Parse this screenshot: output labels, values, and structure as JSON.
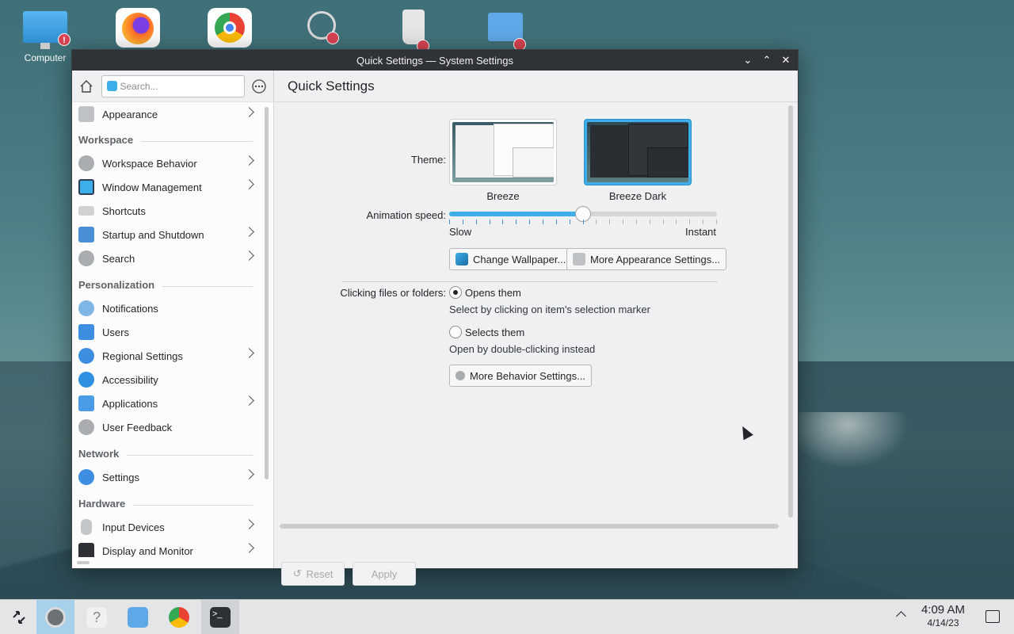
{
  "desktop": {
    "icons": [
      {
        "label": "Computer",
        "icon": "monitor-icon"
      },
      {
        "label": "",
        "icon": "firefox-icon"
      },
      {
        "label": "",
        "icon": "chrome-icon"
      },
      {
        "label": "",
        "icon": "network-icon"
      },
      {
        "label": "",
        "icon": "trash-icon"
      },
      {
        "label": "",
        "icon": "home-folder-icon"
      }
    ],
    "badge": "!"
  },
  "window": {
    "title": "Quick Settings — System Settings",
    "controls": {
      "minimize": "⌄",
      "maximize": "⌃",
      "close": "✕"
    }
  },
  "sidebar": {
    "search_placeholder": "Search...",
    "items": {
      "appearance": "Appearance",
      "workspace_head": "Workspace",
      "workspace_behavior": "Workspace Behavior",
      "window_management": "Window Management",
      "shortcuts": "Shortcuts",
      "startup_shutdown": "Startup and Shutdown",
      "search": "Search",
      "personalization_head": "Personalization",
      "notifications": "Notifications",
      "users": "Users",
      "regional_settings": "Regional Settings",
      "accessibility": "Accessibility",
      "applications": "Applications",
      "user_feedback": "User Feedback",
      "network_head": "Network",
      "settings": "Settings",
      "hardware_head": "Hardware",
      "input_devices": "Input Devices",
      "display_monitor": "Display and Monitor"
    }
  },
  "main": {
    "title": "Quick Settings",
    "theme_label": "Theme:",
    "themes": [
      {
        "name": "Breeze",
        "selected": false
      },
      {
        "name": "Breeze Dark",
        "selected": true
      }
    ],
    "animation_label": "Animation speed:",
    "animation": {
      "min_label": "Slow",
      "max_label": "Instant",
      "value": 0.5,
      "ticks": 20
    },
    "change_wallpaper": "Change Wallpaper...",
    "more_appearance": "More Appearance Settings...",
    "clicking_label": "Clicking files or folders:",
    "opens_them": "Opens them",
    "opens_desc": "Select by clicking on item's selection marker",
    "selects_them": "Selects them",
    "selects_desc": "Open by double-clicking instead",
    "more_behavior": "More Behavior Settings...",
    "reset": "Reset",
    "apply": "Apply"
  },
  "taskbar": {
    "time": "4:09 AM",
    "date": "4/14/23",
    "colors": {
      "active": "#a7d0ea",
      "accent": "#3daee9"
    }
  }
}
